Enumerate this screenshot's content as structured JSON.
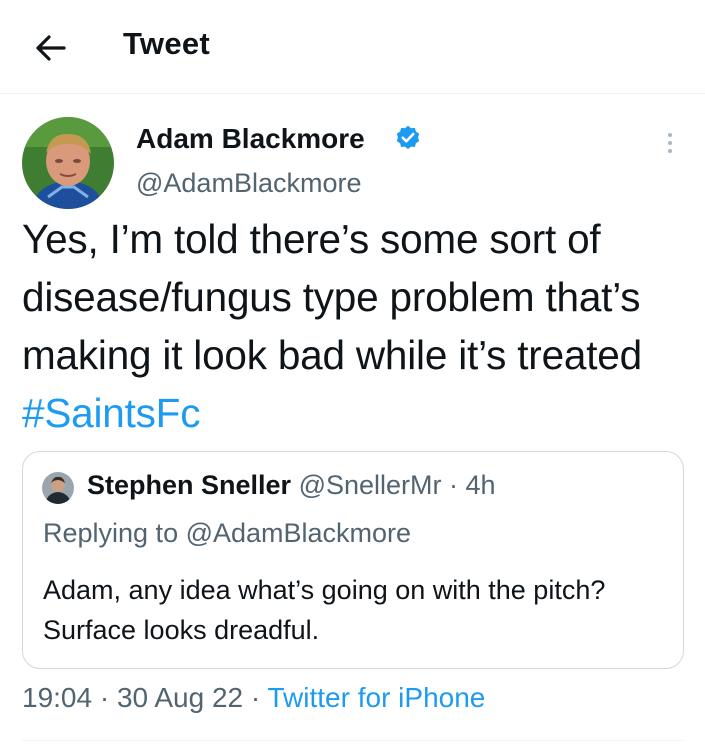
{
  "header": {
    "title": "Tweet"
  },
  "tweet": {
    "author_name": "Adam Blackmore",
    "author_handle": "@AdamBlackmore",
    "verified": true,
    "text": "Yes, I’m told there’s some sort of disease/fungus type problem that’s making it look bad while it’s treated ",
    "hashtag": "#SaintsFc",
    "time": "19:04",
    "date": "30 Aug 22",
    "separator": " · ",
    "source": "Twitter for iPhone"
  },
  "quoted_tweet": {
    "author_name": "Stephen Sneller",
    "author_handle": "@SnellerMr",
    "age": "4h",
    "separator": " · ",
    "replying_to": "Replying to @AdamBlackmore",
    "text": "Adam, any idea what’s going on with the pitch? Surface looks dreadful."
  },
  "colors": {
    "accent": "#1d9bf0",
    "text": "#0f1419",
    "secondary": "#536471",
    "border": "#cfd9de"
  },
  "icons": {
    "back": "back-arrow-icon",
    "verified": "verified-badge-icon",
    "more": "more-vertical-icon"
  }
}
